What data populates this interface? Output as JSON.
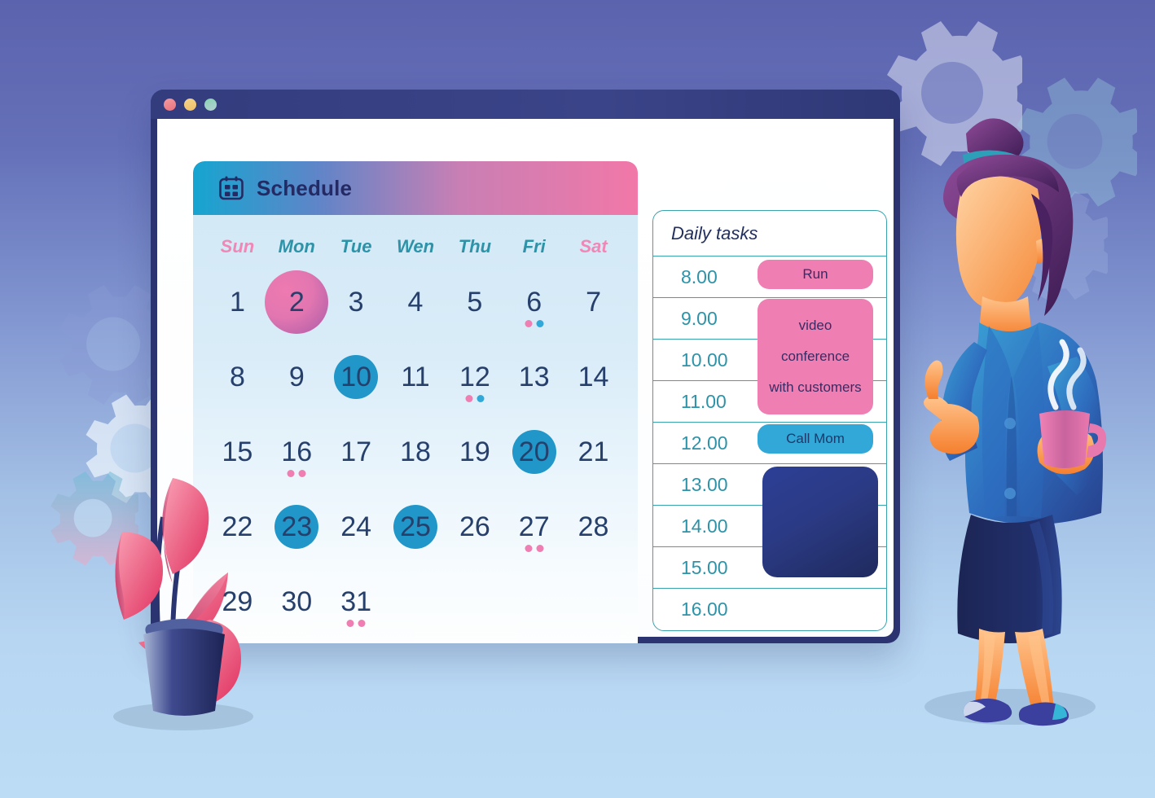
{
  "window": {
    "title_dots": [
      {
        "name": "close",
        "color": "#e8737e"
      },
      {
        "name": "minimize",
        "color": "#eec068"
      },
      {
        "name": "zoom",
        "color": "#86d4b0"
      }
    ]
  },
  "calendar": {
    "icon": "calendar-icon",
    "title": "Schedule",
    "header_gradient_from": "#16a5d0",
    "header_gradient_to": "#f178a8",
    "day_names": [
      {
        "label": "Sun",
        "weekend": true
      },
      {
        "label": "Mon",
        "weekend": false
      },
      {
        "label": "Tue",
        "weekend": false
      },
      {
        "label": "Wen",
        "weekend": false
      },
      {
        "label": "Thu",
        "weekend": false
      },
      {
        "label": "Fri",
        "weekend": false
      },
      {
        "label": "Sat",
        "weekend": true
      }
    ],
    "highlight_pink": "#e276b1",
    "highlight_blue": "#2196c9",
    "weeks": [
      [
        {
          "day": "1"
        },
        {
          "day": "2",
          "highlight": "pink"
        },
        {
          "day": "3"
        },
        {
          "day": "4"
        },
        {
          "day": "5"
        },
        {
          "day": "6",
          "marks": [
            "pink",
            "blue"
          ]
        },
        {
          "day": "7"
        }
      ],
      [
        {
          "day": "8"
        },
        {
          "day": "9"
        },
        {
          "day": "10",
          "highlight": "blue"
        },
        {
          "day": "11"
        },
        {
          "day": "12",
          "marks": [
            "pink",
            "blue"
          ]
        },
        {
          "day": "13"
        },
        {
          "day": "14"
        }
      ],
      [
        {
          "day": "15"
        },
        {
          "day": "16",
          "marks": [
            "pink",
            "pink"
          ]
        },
        {
          "day": "17"
        },
        {
          "day": "18"
        },
        {
          "day": "19"
        },
        {
          "day": "20",
          "highlight": "blue"
        },
        {
          "day": "21"
        }
      ],
      [
        {
          "day": "22"
        },
        {
          "day": "23",
          "highlight": "blue"
        },
        {
          "day": "24"
        },
        {
          "day": "25",
          "highlight": "blue"
        },
        {
          "day": "26"
        },
        {
          "day": "27",
          "marks": [
            "pink",
            "pink"
          ]
        },
        {
          "day": "28"
        }
      ],
      [
        {
          "day": "29"
        },
        {
          "day": "30"
        },
        {
          "day": "31",
          "marks": [
            "pink",
            "pink"
          ]
        },
        {
          "day": ""
        },
        {
          "day": ""
        },
        {
          "day": ""
        },
        {
          "day": ""
        }
      ]
    ]
  },
  "tasks": {
    "title": "Daily tasks",
    "hours": [
      "8.00",
      "9.00",
      "10.00",
      "11.00",
      "12.00",
      "13.00",
      "14.00",
      "15.00",
      "16.00"
    ],
    "blocks": [
      {
        "name": "run",
        "label": "Run",
        "color": "#ef7fb3",
        "start": "8.00",
        "end": "8.00"
      },
      {
        "name": "video-conference",
        "lines": [
          "video",
          "conference",
          "with customers"
        ],
        "color": "#ef7fb3",
        "start": "9.00",
        "end": "11.00"
      },
      {
        "name": "call-mom",
        "label": "Call Mom",
        "color": "#31a8d8",
        "start": "12.00",
        "end": "12.00"
      },
      {
        "name": "blocked-time",
        "label": "",
        "color": "#2c3f96",
        "start": "13.00",
        "end": "15.00"
      }
    ],
    "video_line_1": "video",
    "video_line_2": "conference",
    "video_line_3": "with customers"
  },
  "background": {
    "gradient_top": "#5c63ae",
    "gradient_bottom": "#bcdcf5",
    "decorations": [
      "gear-icon",
      "gear-icon",
      "gear-icon",
      "gear-icon",
      "gear-icon",
      "potted-plant",
      "businesswoman-with-coffee"
    ]
  }
}
